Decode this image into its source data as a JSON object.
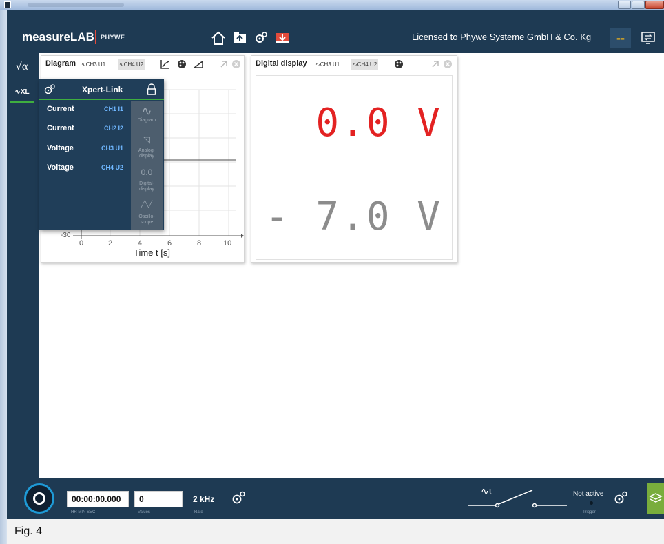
{
  "app": {
    "brand": "measureLAB",
    "brand_sub": "PHYWE",
    "license": "Licensed to Phywe Systeme GmbH & Co. Kg",
    "header_icons": [
      "home-icon",
      "open-folder-icon",
      "settings-gears-icon",
      "save-download-icon"
    ],
    "dash_label": "--"
  },
  "sidebar": {
    "items": [
      {
        "label": "√α",
        "icon": "formula-icon"
      },
      {
        "label": "XL",
        "icon": "xpert-link-icon"
      }
    ]
  },
  "diagram_window": {
    "title": "Diagram",
    "channels": [
      {
        "label": "CH3 U1",
        "selected": false
      },
      {
        "label": "CH4 U2",
        "selected": true
      }
    ],
    "tools": [
      "axis-settings-icon",
      "color-palette-icon",
      "measure-tool-icon"
    ],
    "chart_data": {
      "type": "line",
      "xlabel": "Time t [s]",
      "x_ticks": [
        "0",
        "2",
        "4",
        "6",
        "8",
        "10"
      ],
      "y_ticks": [
        "-30"
      ],
      "xlim": [
        -1,
        10.5
      ]
    }
  },
  "digital_window": {
    "title": "Digital display",
    "channels": [
      {
        "label": "CH3 U1",
        "selected": false
      },
      {
        "label": "CH4 U2",
        "selected": true
      }
    ],
    "value1": "0.0 V",
    "value2": "- 7.0 V",
    "colors": {
      "value1": "#e32222",
      "value2": "#8c8c8c"
    }
  },
  "xpert_link": {
    "title": "Xpert-Link",
    "rows": [
      {
        "type": "Current",
        "channel": "CH1 I1"
      },
      {
        "type": "Current",
        "channel": "CH2 I2"
      },
      {
        "type": "Voltage",
        "channel": "CH3 U1"
      },
      {
        "type": "Voltage",
        "channel": "CH4 U2"
      }
    ],
    "views": [
      {
        "icon": "∿",
        "label": "Diagram"
      },
      {
        "icon": "◹",
        "label": "Analog-display"
      },
      {
        "icon": "0.0",
        "label": "Digital-display"
      },
      {
        "icon": "╱╲╱",
        "label": "Oscillo-scope"
      }
    ]
  },
  "bottombar": {
    "time": "00:00:00.000",
    "time_sub": "HR  MIN  SEC",
    "values": "0",
    "values_sub": "Values",
    "rate": "2 kHz",
    "rate_sub": "Rate",
    "trigger_status": "Not active",
    "trigger_sub": "Trigger"
  },
  "caption": "Fig. 4",
  "colors": {
    "header_bg": "#1e3a53",
    "accent_green": "#3fae3f",
    "channel_blue": "#6fb7ff",
    "license_text": "#ffffff"
  }
}
